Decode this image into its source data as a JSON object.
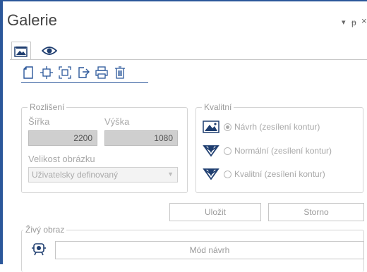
{
  "panel": {
    "title": "Galerie",
    "controls": {
      "dropdown": "▾",
      "pin": "ᵽ",
      "close": "×"
    }
  },
  "tabs": [
    {
      "icon": "gallery-icon"
    },
    {
      "icon": "eye-icon"
    }
  ],
  "toolbar": {
    "icons": [
      "new-page-icon",
      "fit-icon",
      "fullscreen-icon",
      "export-icon",
      "print-icon",
      "delete-icon"
    ]
  },
  "resolution": {
    "legend": "Rozlišení",
    "width_label": "Šířka",
    "width_value": "2200",
    "height_label": "Výška",
    "height_value": "1080",
    "size_label": "Velikost obrázku",
    "size_value": "Uživatelsky definovaný"
  },
  "quality": {
    "legend": "Kvalitní",
    "options": [
      {
        "label": "Návrh (zesílení kontur)",
        "selected": true
      },
      {
        "label": "Normální (zesílení kontur)",
        "selected": false
      },
      {
        "label": "Kvalitní (zesílení kontur)",
        "selected": false
      }
    ]
  },
  "actions": {
    "save": "Uložit",
    "cancel": "Storno"
  },
  "live": {
    "legend": "Živý obraz",
    "mode": "Mód návrh"
  },
  "colors": {
    "accent": "#2b579a",
    "disabled_text": "#a8a8a8",
    "border": "#d4d4d4"
  }
}
